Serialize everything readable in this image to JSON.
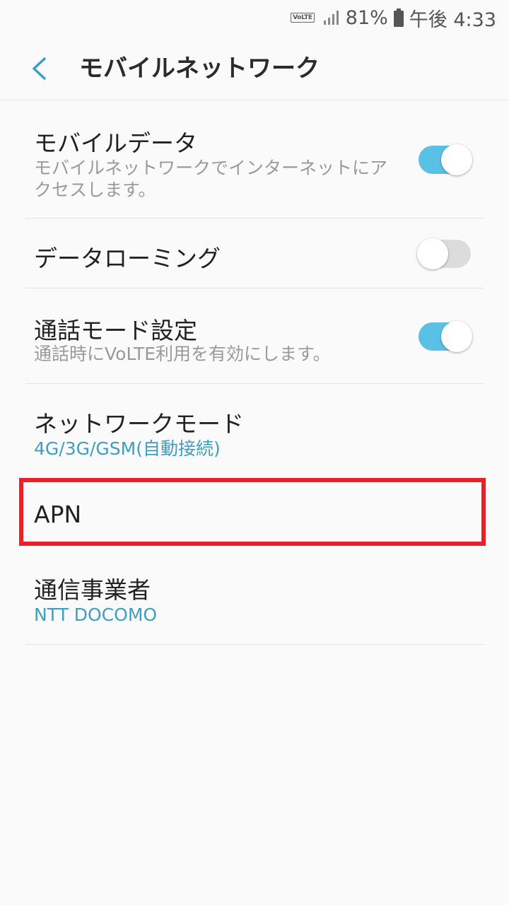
{
  "status_bar": {
    "volte": "VoLTE",
    "battery_percent": "81%",
    "time": "午後 4:33"
  },
  "header": {
    "title": "モバイルネットワーク"
  },
  "items": [
    {
      "title": "モバイルデータ",
      "summary": "モバイルネットワークでインターネットにアクセスします。",
      "toggle": "on"
    },
    {
      "title": "データローミング",
      "toggle": "off"
    },
    {
      "title": "通話モード設定",
      "summary": "通話時にVoLTE利用を有効にします。",
      "toggle": "on"
    },
    {
      "title": "ネットワークモード",
      "summary": "4G/3G/GSM(自動接続)"
    },
    {
      "title": "APN"
    },
    {
      "title": "通信事業者",
      "summary": "NTT DOCOMO"
    }
  ],
  "colors": {
    "accent": "#3e9fc4",
    "toggle_on": "#5bc0e6",
    "highlight": "#e8202a"
  }
}
